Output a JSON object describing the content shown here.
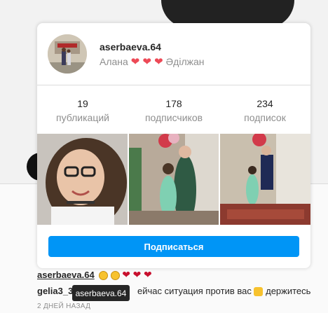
{
  "profile_card": {
    "username": "aserbaeva.64",
    "fullname_prefix": "Алана",
    "fullname_hearts": "❤ ❤ ❤",
    "fullname_suffix": "Әділжан",
    "stats": [
      {
        "count": "19",
        "label": "публикаций"
      },
      {
        "count": "178",
        "label": "подписчиков"
      },
      {
        "count": "234",
        "label": "подписок"
      }
    ],
    "follow_label": "Подписаться"
  },
  "comments": [
    {
      "user": "aserbaeva.64",
      "text": ""
    },
    {
      "user": "gelia3_3",
      "text": "ейчас ситуация против вас",
      "tail": "держитесь"
    }
  ],
  "post_time": "2 ДНЕЙ НАЗАД",
  "tooltip": "aserbaeva.64",
  "colors": {
    "follow_button": "#0095f6",
    "heart": "#ed4956",
    "muted": "#8e8e8e"
  }
}
